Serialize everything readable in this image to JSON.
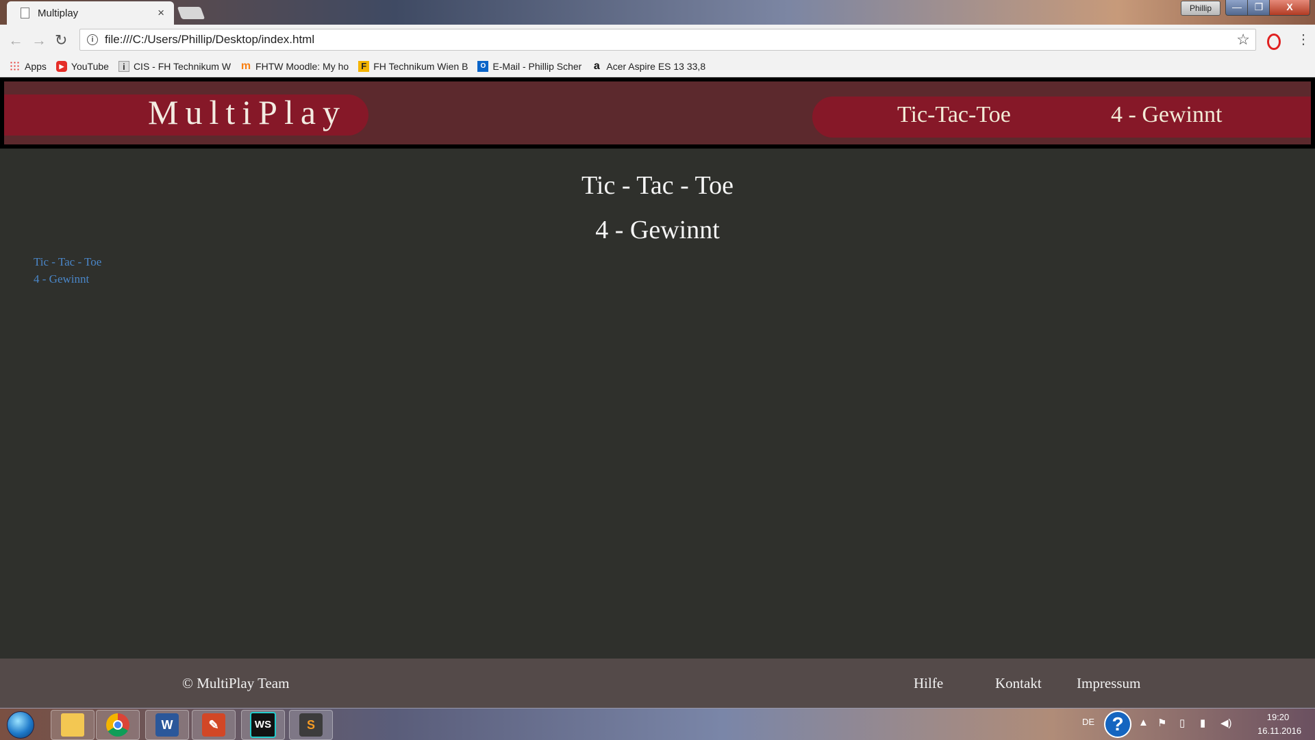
{
  "browser": {
    "tab_title": "Multiplay",
    "tab_close": "×",
    "profile_name": "Phillip",
    "window_controls": {
      "minimize": "—",
      "maximize": "❐",
      "close": "X"
    },
    "nav": {
      "back": "←",
      "forward": "→",
      "reload": "↻"
    },
    "url": "file:///C:/Users/Phillip/Desktop/index.html",
    "info_icon": "i",
    "star": "☆",
    "menu": "⋮",
    "bookmarks": [
      {
        "label": "Apps",
        "icon": "apps-icon",
        "glyph": ""
      },
      {
        "label": "YouTube",
        "icon": "youtube-icon",
        "glyph": "▶"
      },
      {
        "label": "CIS - FH Technikum W",
        "icon": "cis-icon",
        "glyph": "i"
      },
      {
        "label": "FHTW Moodle: My ho",
        "icon": "moodle-icon",
        "glyph": "m"
      },
      {
        "label": "FH Technikum Wien B",
        "icon": "fh-icon",
        "glyph": "F"
      },
      {
        "label": "E-Mail - Phillip Scher",
        "icon": "outlook-icon",
        "glyph": "O"
      },
      {
        "label": "Acer Aspire ES 13 33,8",
        "icon": "amazon-icon",
        "glyph": "a"
      }
    ]
  },
  "site": {
    "logo": "MultiPlay",
    "nav": {
      "tictactoe": "Tic-Tac-Toe",
      "vier_gewinnt": "4 - Gewinnt"
    },
    "headings": {
      "tictactoe": "Tic - Tac - Toe",
      "vier_gewinnt": "4 - Gewinnt"
    },
    "side_links": {
      "tictactoe": "Tic - Tac - Toe",
      "vier_gewinnt": "4 - Gewinnt"
    },
    "footer": {
      "copyright": "© MultiPlay Team",
      "links": {
        "hilfe": "Hilfe",
        "kontakt": "Kontakt",
        "impressum": "Impressum"
      }
    }
  },
  "taskbar": {
    "apps": [
      {
        "name": "explorer",
        "glyph": ""
      },
      {
        "name": "chrome",
        "glyph": ""
      },
      {
        "name": "word",
        "glyph": "W"
      },
      {
        "name": "acrobat",
        "glyph": "✎"
      },
      {
        "name": "webstorm",
        "glyph": "WS"
      },
      {
        "name": "sublime",
        "glyph": "S"
      }
    ],
    "language": "DE",
    "help": "?",
    "tray": {
      "up": "▲",
      "flag": "⚑",
      "battery": "▯",
      "signal": "▮",
      "volume": "◀)"
    },
    "time": "19:20",
    "date": "16.11.2016"
  },
  "colors": {
    "page_bg": "#2f302c",
    "header_bg": "#5c292d",
    "header_pill": "#861828",
    "footer_bg": "#544a49",
    "link": "#4a86c8"
  }
}
